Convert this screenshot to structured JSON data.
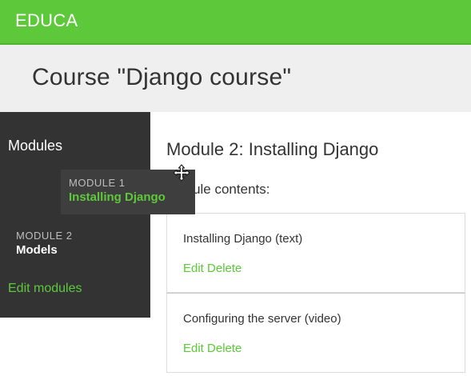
{
  "brand": "EDUCA",
  "page_title": "Course \"Django course\"",
  "sidebar": {
    "heading": "Modules",
    "modules": [
      {
        "number": "MODULE 1",
        "name": "Installing Django",
        "state": "dragging"
      },
      {
        "number": "MODULE 2",
        "name": "Models"
      }
    ],
    "edit_modules": "Edit modules"
  },
  "main": {
    "module_title": "Module 2: Installing Django",
    "contents_label": "Module contents:",
    "contents": [
      {
        "title": "Installing Django (text)",
        "edit": "Edit",
        "delete": "Delete"
      },
      {
        "title": "Configuring the server (video)",
        "edit": "Edit",
        "delete": "Delete"
      }
    ]
  },
  "colors": {
    "accent": "#5dc93a",
    "sidebar_bg": "#333333",
    "titlebar_bg": "#efefef"
  },
  "icons": {
    "cursor": "move-cursor-icon"
  }
}
